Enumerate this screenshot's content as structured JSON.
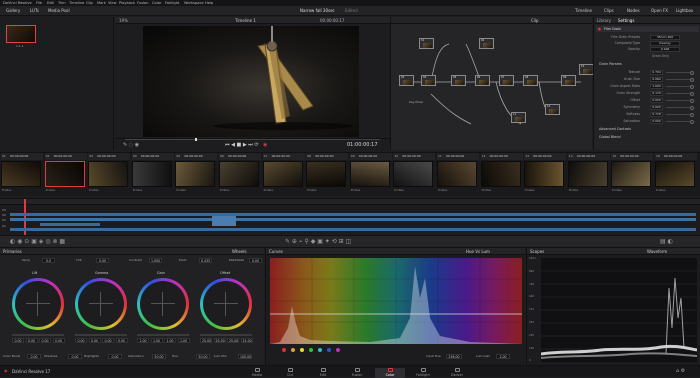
{
  "menu": {
    "items": [
      "DaVinci Resolve",
      "File",
      "Edit",
      "Trim",
      "Timeline",
      "Clip",
      "Mark",
      "View",
      "Playback",
      "Fusion",
      "Color",
      "Fairlight",
      "Workspace",
      "Help"
    ]
  },
  "toolbar": {
    "left": [
      "Gallery",
      "LUTs",
      "Media Pool"
    ],
    "project_title": "Narrow fall 30sec",
    "project_status": "Edited",
    "right": [
      "Timeline",
      "Clips",
      "Nodes",
      "Open FX",
      "Lightbox"
    ]
  },
  "gallery": {
    "still_label": "1.1.1"
  },
  "viewer": {
    "zoom": "19%",
    "timeline_name": "Timeline 1",
    "timecode_top": "00:00:00:17",
    "timecode": "01:00:00:17",
    "clip_label": "Clip"
  },
  "nodes": {
    "node_labels": [
      "01",
      "02",
      "03",
      "04",
      "05",
      "06",
      "07",
      "08",
      "09",
      "10",
      "11",
      "12"
    ],
    "layer_mixer": "Key Mixer"
  },
  "panel": {
    "tabs": [
      "Library",
      "Settings"
    ],
    "fx_title": "Film Grain",
    "rows": [
      {
        "label": "Film Grain Presets",
        "value": "35mm 400"
      },
      {
        "label": "Composite Type",
        "value": "Overlay"
      },
      {
        "label": "Opacity",
        "value": "0.166"
      }
    ],
    "grain_only": "Grain Only",
    "section_params": "Grain Params",
    "params": [
      {
        "label": "Texture",
        "value": "0.704"
      },
      {
        "label": "Grain Size",
        "value": "0.062"
      },
      {
        "label": "Grain Aspect Ratio",
        "value": "1.000"
      },
      {
        "label": "Grain Strength",
        "value": "0.170"
      },
      {
        "label": "Offset",
        "value": "0.000"
      },
      {
        "label": "Symmetry",
        "value": "0.000"
      },
      {
        "label": "Softness",
        "value": "0.718"
      },
      {
        "label": "Saturation",
        "value": "0.000"
      }
    ],
    "sections": [
      "Advanced Controls",
      "Global Blend"
    ]
  },
  "clips": {
    "items": [
      {
        "num": "01",
        "tc": "00:00:00:00",
        "codec": "ProRes"
      },
      {
        "num": "02",
        "tc": "00:00:00:00",
        "codec": "ProRes"
      },
      {
        "num": "03",
        "tc": "00:00:00:00",
        "codec": "ProRes"
      },
      {
        "num": "04",
        "tc": "00:00:00:00",
        "codec": "ProRes"
      },
      {
        "num": "05",
        "tc": "00:00:00:00",
        "codec": "ProRes"
      },
      {
        "num": "06",
        "tc": "00:00:00:00",
        "codec": "ProRes"
      },
      {
        "num": "07",
        "tc": "00:00:00:00",
        "codec": "ProRes"
      },
      {
        "num": "08",
        "tc": "00:00:00:00",
        "codec": "ProRes"
      },
      {
        "num": "09",
        "tc": "00:00:00:00",
        "codec": "ProRes"
      },
      {
        "num": "10",
        "tc": "00:00:00:00",
        "codec": "ProRes"
      },
      {
        "num": "11",
        "tc": "00:00:00:00",
        "codec": "ProRes"
      },
      {
        "num": "12",
        "tc": "00:00:00:00",
        "codec": "ProRes"
      },
      {
        "num": "13",
        "tc": "00:00:00:00",
        "codec": "ProRes"
      },
      {
        "num": "14",
        "tc": "00:00:00:00",
        "codec": "ProRes"
      },
      {
        "num": "15",
        "tc": "00:00:00:00",
        "codec": "ProRes"
      },
      {
        "num": "16",
        "tc": "00:00:00:00",
        "codec": "ProRes"
      }
    ]
  },
  "timeline": {
    "tracks": [
      "V3",
      "V2",
      "V1",
      "A1"
    ]
  },
  "wheels": {
    "title": "Primaries",
    "mode": "Wheels",
    "top_controls": [
      {
        "label": "Temp",
        "value": "0.0"
      },
      {
        "label": "Tint",
        "value": "0.00"
      },
      {
        "label": "Contrast",
        "value": "1.000"
      },
      {
        "label": "Pivot",
        "value": "0.435"
      },
      {
        "label": "Mid/Detail",
        "value": "0.00"
      }
    ],
    "items": [
      {
        "name": "Lift",
        "values": [
          "0.00",
          "0.00",
          "0.00",
          "0.00"
        ]
      },
      {
        "name": "Gamma",
        "values": [
          "0.00",
          "0.00",
          "0.00",
          "0.00"
        ]
      },
      {
        "name": "Gain",
        "values": [
          "1.00",
          "1.00",
          "1.00",
          "1.00"
        ]
      },
      {
        "name": "Offset",
        "values": [
          "25.00",
          "25.00",
          "25.00",
          "25.00"
        ]
      }
    ],
    "bottom_controls": [
      {
        "label": "Color Boost",
        "value": "0.00"
      },
      {
        "label": "Shadows",
        "value": "0.00"
      },
      {
        "label": "Highlights",
        "value": "0.00"
      },
      {
        "label": "Saturation",
        "value": "50.00"
      },
      {
        "label": "Hue",
        "value": "50.00"
      },
      {
        "label": "Lum Mix",
        "value": "100.00"
      }
    ]
  },
  "curves": {
    "title": "Curves",
    "mode": "Hue Vs Lum",
    "input_label": "Input Hue",
    "input_value": "256.00",
    "output_label": "Lum Gain",
    "output_value": "1.00"
  },
  "scopes": {
    "title": "Scopes",
    "mode": "Waveform",
    "scale": [
      "1023",
      "896",
      "768",
      "640",
      "512",
      "384",
      "256",
      "128",
      "0"
    ]
  },
  "pagenav": {
    "app": "DaVinci Resolve 17",
    "pages": [
      "Media",
      "Cut",
      "Edit",
      "Fusion",
      "Color",
      "Fairlight",
      "Deliver"
    ],
    "active": "Color"
  },
  "colors": {
    "accent": "#e0393e",
    "wheel_lift": "#d6d6d6",
    "playhead": "#e0393e"
  }
}
